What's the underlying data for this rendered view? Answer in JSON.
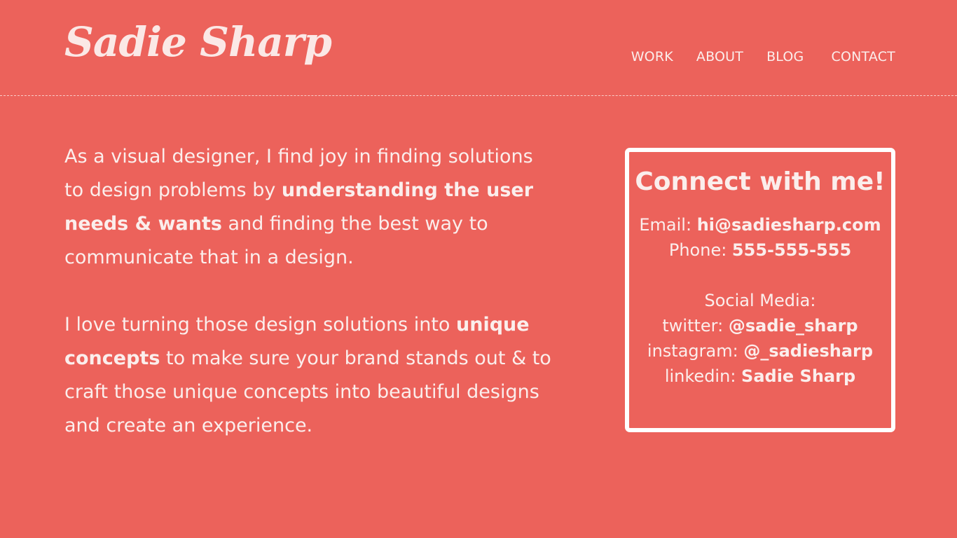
{
  "header": {
    "logo": "Sadie Sharp",
    "nav": [
      "WORK",
      "ABOUT",
      "BLOG",
      "CONTACT"
    ]
  },
  "intro": {
    "p1": {
      "before": "As a visual designer, I find joy in finding solutions to design problems by ",
      "strong": "understanding the user needs & wants",
      "after": " and finding the best way to communicate that in a design."
    },
    "p2": {
      "before": "I love turning those design solutions into ",
      "strong": "unique concepts",
      "after": " to make sure your brand stands out & to craft those unique concepts into beautiful designs and create an experience."
    }
  },
  "contact_card": {
    "title": "Connect with me!",
    "email_label": "Email: ",
    "email": "hi@sadiesharp.com",
    "phone_label": "Phone: ",
    "phone": "555-555-555",
    "social_label": "Social Media:",
    "twitter_label": "twitter: ",
    "twitter": "@sadie_sharp",
    "instagram_label": "instagram: ",
    "instagram": "@_sadiesharp",
    "linkedin_label": "linkedin: ",
    "linkedin": "Sadie Sharp"
  },
  "colors": {
    "background": "#ec625b",
    "text": "#fbeeec",
    "card_border": "#ffffff"
  }
}
